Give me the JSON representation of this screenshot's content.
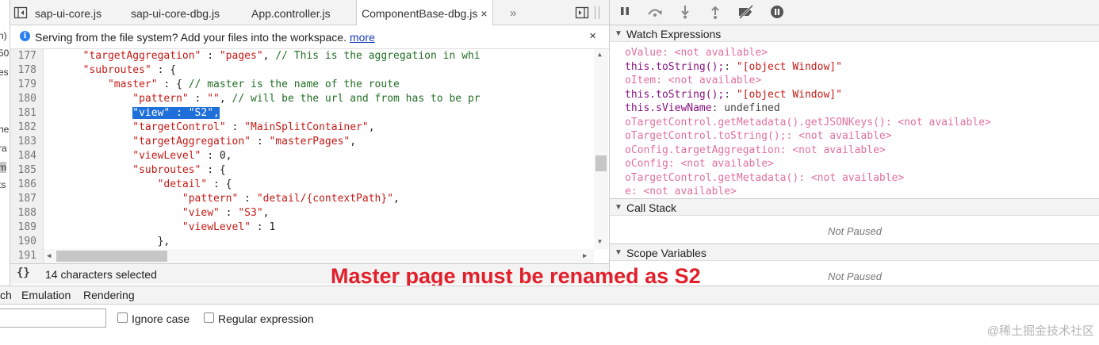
{
  "left_nav": {
    "fragments": [
      "n)",
      "50",
      "es",
      "he",
      "ra",
      "m",
      "ts"
    ]
  },
  "tabs": [
    {
      "label": "sap-ui-core.js"
    },
    {
      "label": "sap-ui-core-dbg.js"
    },
    {
      "label": "App.controller.js"
    },
    {
      "label": "ComponentBase-dbg.js",
      "active": true,
      "close": "×"
    }
  ],
  "tab_overflow": "»",
  "info_banner": {
    "icon": "info-icon",
    "text": "Serving from the file system? Add your files into the workspace.",
    "link": "more",
    "close": "×"
  },
  "code": {
    "lines": [
      {
        "n": "177",
        "indent": "  ",
        "parts": [
          [
            "s",
            "\"targetAggregation\""
          ],
          [
            "p",
            " : "
          ],
          [
            "s",
            "\"pages\""
          ],
          [
            "p",
            ", "
          ],
          [
            "c",
            "// This is the aggregation in whi"
          ]
        ]
      },
      {
        "n": "178",
        "indent": "  ",
        "parts": [
          [
            "s",
            "\"subroutes\""
          ],
          [
            "p",
            " : {"
          ]
        ]
      },
      {
        "n": "179",
        "indent": "      ",
        "parts": [
          [
            "s",
            "\"master\""
          ],
          [
            "p",
            " : { "
          ],
          [
            "c",
            "// master is the name of the route"
          ]
        ]
      },
      {
        "n": "180",
        "indent": "          ",
        "parts": [
          [
            "s",
            "\"pattern\""
          ],
          [
            "p",
            " : "
          ],
          [
            "s",
            "\"\""
          ],
          [
            "p",
            ", "
          ],
          [
            "c",
            "// will be the url and from has to be pr"
          ]
        ]
      },
      {
        "n": "181",
        "indent": "          ",
        "parts": [
          [
            "h",
            "\"view\" : \"S2\","
          ]
        ]
      },
      {
        "n": "182",
        "indent": "          ",
        "parts": [
          [
            "s",
            "\"targetControl\""
          ],
          [
            "p",
            " : "
          ],
          [
            "s",
            "\"MainSplitContainer\""
          ],
          [
            "p",
            ","
          ]
        ]
      },
      {
        "n": "183",
        "indent": "          ",
        "parts": [
          [
            "s",
            "\"targetAggregation\""
          ],
          [
            "p",
            " : "
          ],
          [
            "s",
            "\"masterPages\""
          ],
          [
            "p",
            ","
          ]
        ]
      },
      {
        "n": "184",
        "indent": "          ",
        "parts": [
          [
            "s",
            "\"viewLevel\""
          ],
          [
            "p",
            " : 0,"
          ]
        ]
      },
      {
        "n": "185",
        "indent": "          ",
        "parts": [
          [
            "s",
            "\"subroutes\""
          ],
          [
            "p",
            " : {"
          ]
        ]
      },
      {
        "n": "186",
        "indent": "              ",
        "parts": [
          [
            "s",
            "\"detail\""
          ],
          [
            "p",
            " : {"
          ]
        ]
      },
      {
        "n": "187",
        "indent": "                  ",
        "parts": [
          [
            "s",
            "\"pattern\""
          ],
          [
            "p",
            " : "
          ],
          [
            "s",
            "\"detail/{contextPath}\""
          ],
          [
            "p",
            ","
          ]
        ]
      },
      {
        "n": "188",
        "indent": "                  ",
        "parts": [
          [
            "s",
            "\"view\""
          ],
          [
            "p",
            " : "
          ],
          [
            "s",
            "\"S3\""
          ],
          [
            "p",
            ","
          ]
        ]
      },
      {
        "n": "189",
        "indent": "                  ",
        "parts": [
          [
            "s",
            "\"viewLevel\""
          ],
          [
            "p",
            " : 1"
          ]
        ]
      },
      {
        "n": "190",
        "indent": "              ",
        "parts": [
          [
            "p",
            "},"
          ]
        ]
      },
      {
        "n": "191",
        "indent": "",
        "parts": [
          [
            "p",
            ""
          ]
        ]
      }
    ]
  },
  "status_bar": {
    "braces": "{}",
    "selection": "14 characters selected"
  },
  "debugger_toolbar": {
    "buttons": [
      "pause-icon",
      "step-over-icon",
      "step-into-icon",
      "step-out-icon",
      "deactivate-breakpoints-icon",
      "pause-on-exceptions-icon"
    ]
  },
  "sections": {
    "watch": "Watch Expressions",
    "call_stack": "Call Stack",
    "scope": "Scope Variables"
  },
  "watch_expressions": [
    {
      "expr": "oValue",
      "value": "<not available>",
      "available": false
    },
    {
      "expr": "this.toString();",
      "value": "\"[object Window]\"",
      "available": true,
      "kind": "string"
    },
    {
      "expr": "oItem",
      "value": "<not available>",
      "available": false
    },
    {
      "expr": "this.toString();",
      "value": "\"[object Window]\"",
      "available": true,
      "kind": "string"
    },
    {
      "expr": "this.sViewName",
      "value": "undefined",
      "available": true,
      "kind": "undefined"
    },
    {
      "expr": "oTargetControl.getMetadata().getJSONKeys()",
      "value": "<not available>",
      "available": false
    },
    {
      "expr": "oTargetControl.toString();",
      "value": "<not available>",
      "available": false
    },
    {
      "expr": "oConfig.targetAggregation",
      "value": "<not available>",
      "available": false
    },
    {
      "expr": "oConfig",
      "value": "<not available>",
      "available": false
    },
    {
      "expr": "oTargetControl.getMetadata()",
      "value": "<not available>",
      "available": false
    },
    {
      "expr": "e",
      "value": "<not available>",
      "available": false
    }
  ],
  "not_paused": "Not Paused",
  "annotation": "Master page must be renamed as S2",
  "drawer_tabs": [
    "ch",
    "Emulation",
    "Rendering"
  ],
  "search": {
    "value": "",
    "ignore_case": "Ignore case",
    "regex": "Regular expression"
  },
  "watermark": "@稀土掘金技术社区",
  "colors": {
    "annotation": "#e2202b",
    "selection": "#1e6fd9",
    "string": "#c41a16",
    "comment": "#236e25",
    "not_available": "#e0709f",
    "keyword": "#881280"
  }
}
